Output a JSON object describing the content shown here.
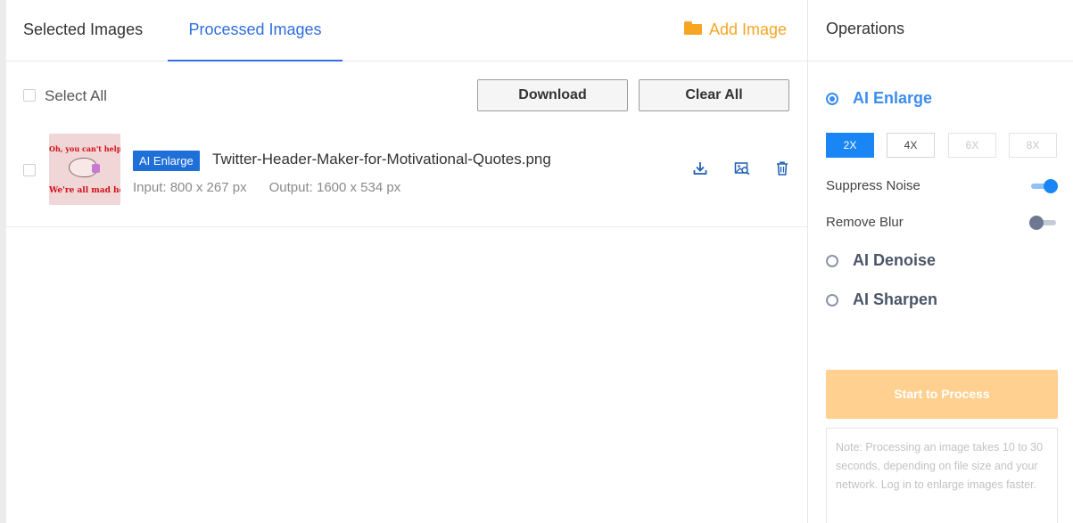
{
  "tabs": {
    "selected_images": "Selected Images",
    "processed_images": "Processed Images",
    "active": "processed_images"
  },
  "add_image": {
    "label": "Add Image",
    "icon": "folder-icon",
    "color": "#f5a623"
  },
  "toolbar": {
    "select_all": "Select All",
    "download": "Download",
    "clear_all": "Clear All"
  },
  "file": {
    "badge": "AI Enlarge",
    "name": "Twitter-Header-Maker-for-Motivational-Quotes.png",
    "input": "Input: 800 x 267 px",
    "output": "Output: 1600 x 534 px",
    "thumbnail_text_top": "Oh, you can't help that",
    "thumbnail_text_bottom": "We're all mad here",
    "actions": [
      "download-icon",
      "preview-icon",
      "trash-icon"
    ]
  },
  "operations": {
    "title": "Operations",
    "enlarge": {
      "label": "AI Enlarge",
      "selected": true,
      "scales": [
        {
          "label": "2X",
          "state": "active"
        },
        {
          "label": "4X",
          "state": "normal"
        },
        {
          "label": "6X",
          "state": "disabled"
        },
        {
          "label": "8X",
          "state": "disabled"
        }
      ],
      "suppress_noise": {
        "label": "Suppress Noise",
        "on": true
      },
      "remove_blur": {
        "label": "Remove Blur",
        "on": false
      }
    },
    "denoise": {
      "label": "AI Denoise",
      "selected": false
    },
    "sharpen": {
      "label": "AI Sharpen",
      "selected": false
    },
    "start": "Start to Process",
    "note": "Note: Processing an image takes 10 to 30 seconds, depending on file size and your network. Log in to enlarge images faster."
  },
  "colors": {
    "accent": "#2f6fe0",
    "radio_active": "#3b8ef0",
    "badge": "#1f6fd8",
    "start_button": "#ffd08f"
  }
}
